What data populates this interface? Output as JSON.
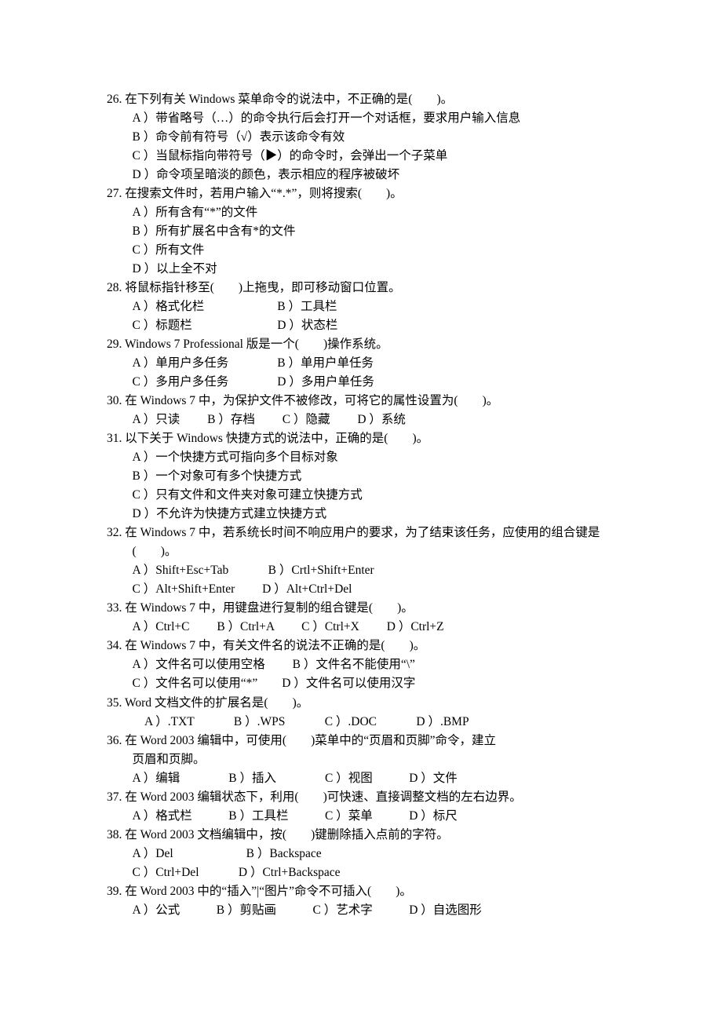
{
  "questions": [
    {
      "num": "26.",
      "stem": "在下列有关 Windows 菜单命令的说法中，不正确的是(　　)。",
      "lines": [
        "A ）带省略号（…）的命令执行后会打开一个对话框，要求用户输入信息",
        "B ）命令前有符号（√）表示该命令有效",
        "C ）当鼠标指向带符号（▶）的命令时，会弹出一个子菜单",
        "D ）命令项呈暗淡的颜色，表示相应的程序被破坏"
      ]
    },
    {
      "num": "27.",
      "stem": "在搜索文件时，若用户输入“*.*”，则将搜索(　　)。",
      "lines": [
        "A ）所有含有“*”的文件",
        "B ）所有扩展名中含有*的文件",
        "C ）所有文件",
        "D ）以上全不对"
      ]
    },
    {
      "num": "28.",
      "stem": "将鼠标指针移至(　　)上拖曳，即可移动窗口位置。",
      "lines": [
        "A ）格式化栏　　　　　　B ）工具栏",
        "C ）标题栏　　　　　　　D ）状态栏"
      ]
    },
    {
      "num": "29.",
      "stem": "Windows 7 Professional 版是一个(　　)操作系统。",
      "lines": [
        "A ）单用户多任务　　　　B ）单用户单任务",
        "C ）多用户多任务　　　　D ）多用户单任务"
      ]
    },
    {
      "num": "30.",
      "stem": "在 Windows 7 中，为保护文件不被修改，可将它的属性设置为(　　)。",
      "lines": [
        "A ）只读　　 B ）存档　　 C ）隐藏　　 D ）系统"
      ]
    },
    {
      "num": "31.",
      "stem": "以下关于 Windows 快捷方式的说法中，正确的是(　　)。",
      "lines": [
        "A ）一个快捷方式可指向多个目标对象",
        "B ）一个对象可有多个快捷方式",
        "C ）只有文件和文件夹对象可建立快捷方式",
        "D ）不允许为快捷方式建立快捷方式"
      ]
    },
    {
      "num": "32.",
      "stem": "在 Windows 7 中，若系统长时间不响应用户的要求，为了结束该任务，应使用的组合键是",
      "cont": "(　　)。",
      "lines": [
        "A ）Shift+Esc+Tab　　　 B ）Crtl+Shift+Enter",
        "C ）Alt+Shift+Enter　　 D ）Alt+Ctrl+Del"
      ]
    },
    {
      "num": "33.",
      "stem": "在 Windows 7 中，用键盘进行复制的组合键是(　　)。",
      "lines": [
        "A ）Ctrl+C　　 B ）Ctrl+A　　 C ）Ctrl+X　　 D ）Ctrl+Z"
      ]
    },
    {
      "num": "34.",
      "stem": "在 Windows 7 中，有关文件名的说法不正确的是(　　)。",
      "lines": [
        "A ）文件名可以使用空格　　 B ）文件名不能使用“\\”",
        "C ）文件名可以使用“*”　　D ）文件名可以使用汉字"
      ]
    },
    {
      "num": "35.",
      "stem": "Word 文档文件的扩展名是(　　)。",
      "lines": [
        " A ）.TXT　　　 B ）.WPS　　　 C ）.DOC　　　 D ）.BMP"
      ]
    },
    {
      "num": "36.",
      "stem": "在 Word 2003 编辑中，可使用(　　)菜单中的“页眉和页脚”命令，建立",
      "cont": "页眉和页脚。",
      "lines": [
        "A ）编辑　　　　B ）插入　　　　C ）视图　　　D ）文件"
      ]
    },
    {
      "num": "37.",
      "stem": "在 Word 2003 编辑状态下，利用(　　)可快速、直接调整文档的左右边界。",
      "lines": [
        "A ）格式栏　　　B ）工具栏　　　C ）菜单　　　D ）标尺"
      ]
    },
    {
      "num": "38.",
      "stem": "在 Word 2003 文档编辑中，按(　　)键删除插入点前的字符。",
      "lines": [
        "A ）Del　　　　　　B ）Backspace",
        "C ）Ctrl+Del　　　 D ）Ctrl+Backspace"
      ]
    },
    {
      "num": "39.",
      "stem": "在 Word 2003 中的“插入”|“图片”命令不可插入(　　)。",
      "lines": [
        "A ）公式　　　B ）剪贴画　　　C ）艺术字　　　D ）自选图形"
      ]
    }
  ]
}
